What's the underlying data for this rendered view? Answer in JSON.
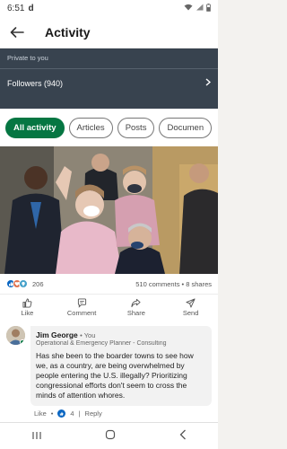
{
  "status_bar": {
    "time": "6:51",
    "notification_icon": "d"
  },
  "app_bar": {
    "title": "Activity"
  },
  "private_section": {
    "label": "Private to you",
    "followers": "Followers (940)"
  },
  "filter_chips": [
    {
      "label": "All activity",
      "active": true
    },
    {
      "label": "Articles",
      "active": false
    },
    {
      "label": "Posts",
      "active": false
    },
    {
      "label": "Documen",
      "active": false
    }
  ],
  "post": {
    "reactions_count": "206",
    "comments_shares": "510 comments • 8 shares",
    "actions": {
      "like": "Like",
      "comment": "Comment",
      "share": "Share",
      "send": "Send"
    }
  },
  "comment": {
    "name": "Jim George",
    "degree": "• You",
    "headline": "Operational & Emergency Planner - Consulting",
    "text": "Has she been to the boarder towns to see how we, as a country, are being overwhelmed by people entering the U.S. illegally? Prioritizing congressional efforts don't seem to cross the minds of attention whores.",
    "like_label": "Like",
    "like_count": "4",
    "reply_label": "Reply"
  },
  "colors": {
    "brand_green": "#057642",
    "private_band": "#38434f",
    "like_blue": "#0a66c2"
  }
}
